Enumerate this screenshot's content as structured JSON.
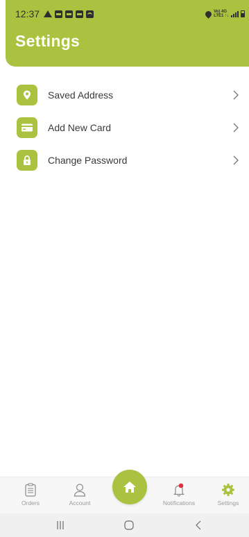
{
  "status_bar": {
    "time": "12:37",
    "network_top": "Vo) 4G",
    "network_bottom": "LTE1 ↑↓"
  },
  "header": {
    "title": "Settings"
  },
  "menu": {
    "items": [
      {
        "label": "Saved Address",
        "icon": "location-pin-icon"
      },
      {
        "label": "Add New Card",
        "icon": "credit-card-icon"
      },
      {
        "label": "Change Password",
        "icon": "lock-icon"
      }
    ]
  },
  "bottom_nav": {
    "items": [
      {
        "label": "Orders",
        "icon": "clipboard-icon"
      },
      {
        "label": "Account",
        "icon": "user-icon"
      },
      {
        "label": "Notifications",
        "icon": "bell-icon"
      },
      {
        "label": "Settings",
        "icon": "gear-icon"
      }
    ],
    "home_icon": "home-icon"
  },
  "colors": {
    "accent": "#a9c23f",
    "notification_dot": "#d9343c",
    "text": "#3a3a3a",
    "muted": "#9a9a9a"
  }
}
